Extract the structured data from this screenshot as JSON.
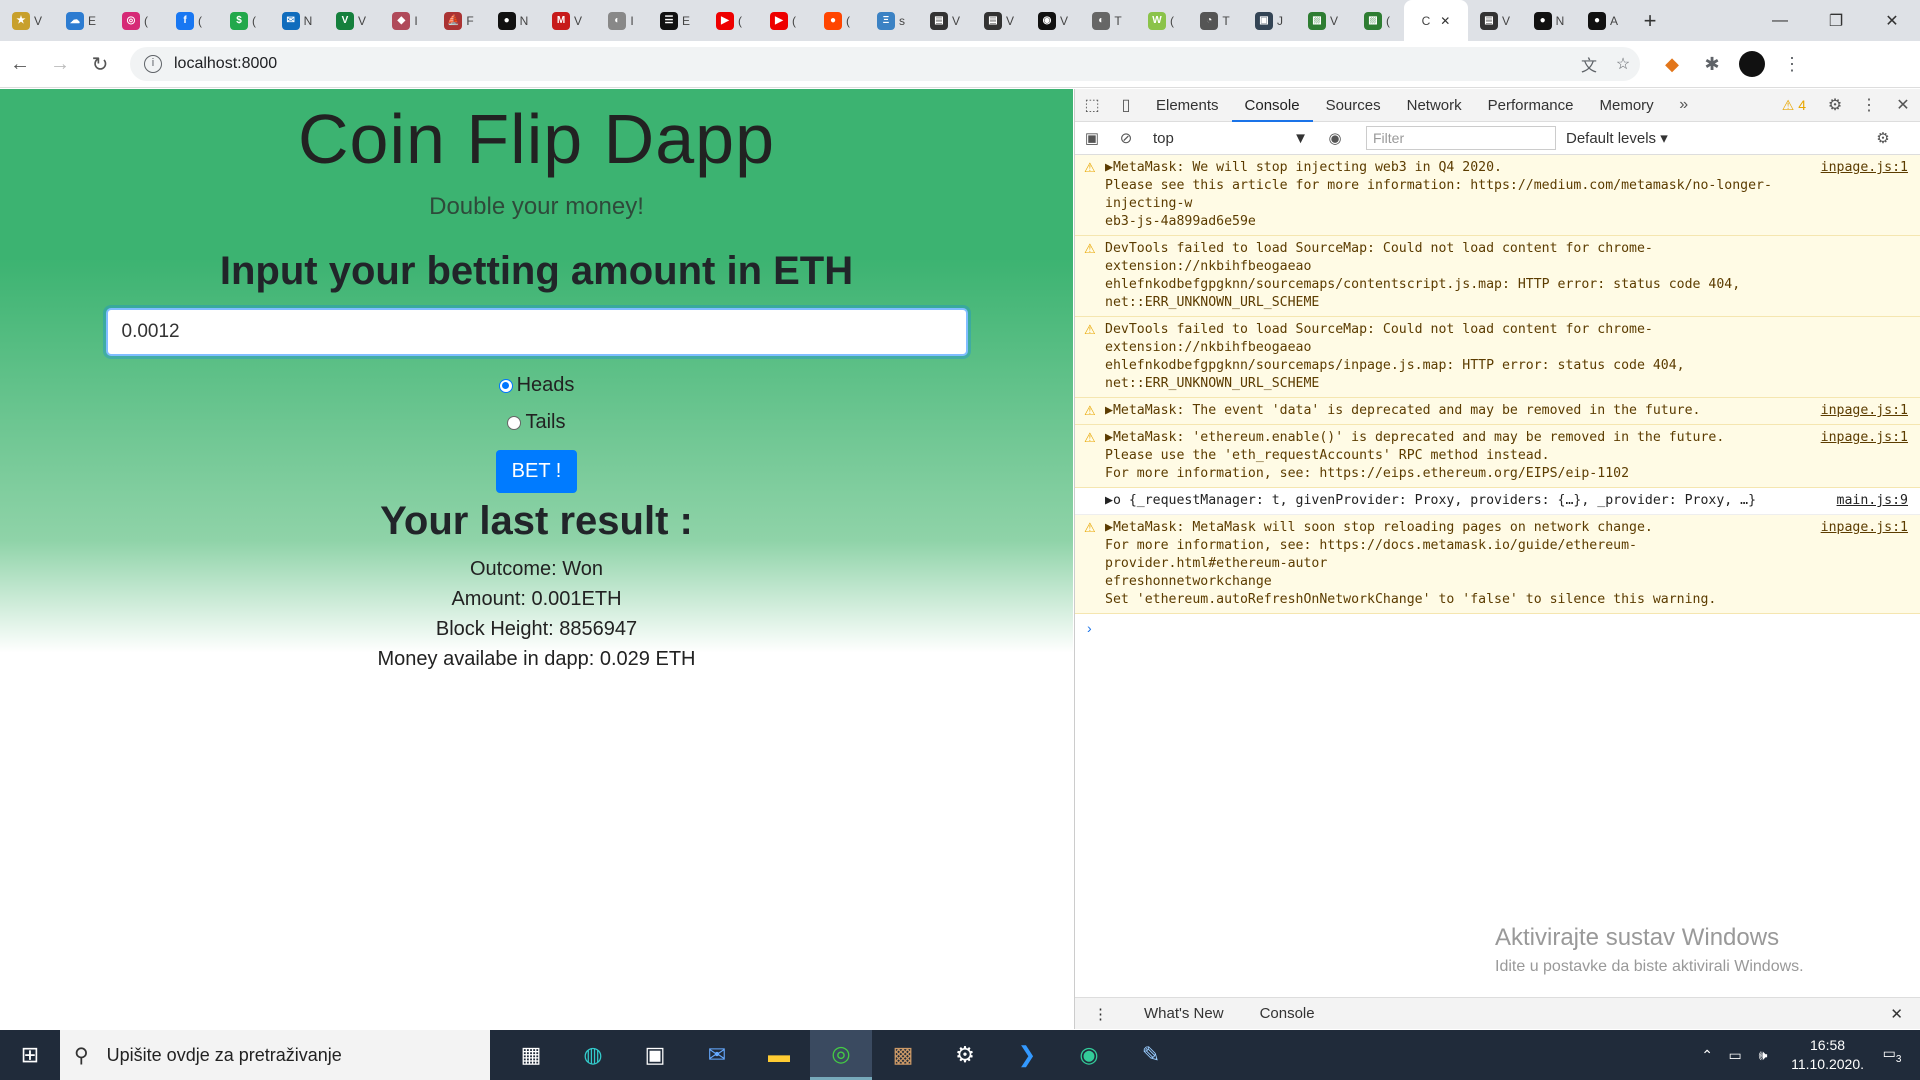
{
  "browser": {
    "tabs": [
      {
        "icon": "★",
        "label": "V",
        "color": "#c8a02c"
      },
      {
        "icon": "☁",
        "label": "E",
        "color": "#2d7cd1"
      },
      {
        "icon": "◎",
        "label": "(",
        "color": "#d62976"
      },
      {
        "icon": "f",
        "label": "(",
        "color": "#1877f2"
      },
      {
        "icon": "$",
        "label": "(",
        "color": "#22a84b"
      },
      {
        "icon": "✉",
        "label": "N",
        "color": "#0f6cbd"
      },
      {
        "icon": "V",
        "label": "V",
        "color": "#15803d"
      },
      {
        "icon": "◆",
        "label": "I",
        "color": "#b04a5a"
      },
      {
        "icon": "⛵",
        "label": "F",
        "color": "#a33"
      },
      {
        "icon": "●",
        "label": "N",
        "color": "#111"
      },
      {
        "icon": "M",
        "label": "V",
        "color": "#c71a1a"
      },
      {
        "icon": "◐",
        "label": "I",
        "color": "#888"
      },
      {
        "icon": "☰",
        "label": "E",
        "color": "#111"
      },
      {
        "icon": "▶",
        "label": "(",
        "color": "#e00"
      },
      {
        "icon": "▶",
        "label": "(",
        "color": "#e00"
      },
      {
        "icon": "●",
        "label": "(",
        "color": "#ff4500"
      },
      {
        "icon": "Ξ",
        "label": "s",
        "color": "#3b82c4"
      },
      {
        "icon": "▤",
        "label": "V",
        "color": "#333"
      },
      {
        "icon": "▤",
        "label": "V",
        "color": "#333"
      },
      {
        "icon": "◉",
        "label": "V",
        "color": "#111"
      },
      {
        "icon": "◐",
        "label": "T",
        "color": "#666"
      },
      {
        "icon": "W",
        "label": "(",
        "color": "#8bc34a"
      },
      {
        "icon": "◔",
        "label": "T",
        "color": "#555"
      },
      {
        "icon": "▣",
        "label": "J",
        "color": "#345"
      },
      {
        "icon": "▨",
        "label": "V",
        "color": "#2e7d32"
      },
      {
        "icon": "▨",
        "label": "(",
        "color": "#2e7d32"
      },
      {
        "icon": "",
        "label": "C",
        "color": "#fff"
      },
      {
        "icon": "▤",
        "label": "V",
        "color": "#333"
      },
      {
        "icon": "●",
        "label": "N",
        "color": "#111"
      },
      {
        "icon": "●",
        "label": "A",
        "color": "#111"
      }
    ],
    "active_tab_label": "C",
    "url": "localhost:8000"
  },
  "page": {
    "title": "Coin Flip Dapp",
    "subtitle": "Double your money!",
    "input_heading": "Input your betting amount in ETH",
    "bet_amount": "0.0012",
    "radio_heads": "Heads",
    "radio_tails": "Tails",
    "selected": "Heads",
    "bet_button": "BET !",
    "result_heading": "Your last result :",
    "outcome": "Outcome: Won",
    "amount": "Amount: 0.001ETH",
    "block_height": "Block Height: 8856947",
    "money_available": "Money availabe in dapp: 0.029 ETH"
  },
  "devtools": {
    "tabs": [
      "Elements",
      "Console",
      "Sources",
      "Network",
      "Performance",
      "Memory"
    ],
    "active_tab": "Console",
    "warning_count": "4",
    "context": "top",
    "filter_placeholder": "Filter",
    "levels": "Default levels",
    "messages": [
      {
        "type": "warn",
        "lines": [
          "▶MetaMask: We will stop injecting web3 in Q4 2020.",
          "Please see this article for more information: https://medium.com/metamask/no-longer-injecting-w",
          "eb3-js-4a899ad6e59e"
        ],
        "source": "inpage.js:1"
      },
      {
        "type": "warn",
        "lines": [
          "DevTools failed to load SourceMap: Could not load content for chrome-extension://nkbihfbeogaeao",
          "ehlefnkodbefgpgknn/sourcemaps/contentscript.js.map: HTTP error: status code 404,",
          "net::ERR_UNKNOWN_URL_SCHEME"
        ],
        "source": ""
      },
      {
        "type": "warn",
        "lines": [
          "DevTools failed to load SourceMap: Could not load content for chrome-extension://nkbihfbeogaeao",
          "ehlefnkodbefgpgknn/sourcemaps/inpage.js.map: HTTP error: status code 404,",
          "net::ERR_UNKNOWN_URL_SCHEME"
        ],
        "source": ""
      },
      {
        "type": "warn",
        "lines": [
          "▶MetaMask: The event 'data' is deprecated and may be removed in the future."
        ],
        "source": "inpage.js:1"
      },
      {
        "type": "warn",
        "lines": [
          "▶MetaMask: 'ethereum.enable()' is deprecated and may be removed in the future.",
          "Please use the 'eth_requestAccounts' RPC method instead.",
          "For more information, see: https://eips.ethereum.org/EIPS/eip-1102"
        ],
        "source": "inpage.js:1"
      },
      {
        "type": "log",
        "lines": [
          "▶o {_requestManager: t, givenProvider: Proxy, providers: {…}, _provider: Proxy, …}"
        ],
        "source": "main.js:9"
      },
      {
        "type": "warn",
        "lines": [
          "▶MetaMask: MetaMask will soon stop reloading pages on network change.",
          "For more information, see: https://docs.metamask.io/guide/ethereum-provider.html#ethereum-autor",
          "efreshonnetworkchange",
          "Set 'ethereum.autoRefreshOnNetworkChange' to 'false' to silence this warning."
        ],
        "source": "inpage.js:1"
      }
    ],
    "watermark_title": "Aktivirajte sustav Windows",
    "watermark_sub": "Idite u postavke da biste aktivirali Windows.",
    "drawer_tabs": [
      "What's New",
      "Console"
    ]
  },
  "taskbar": {
    "search_placeholder": "Upišite ovdje za pretraživanje",
    "time": "16:58",
    "date": "11.10.2020.",
    "notifications": "3"
  }
}
